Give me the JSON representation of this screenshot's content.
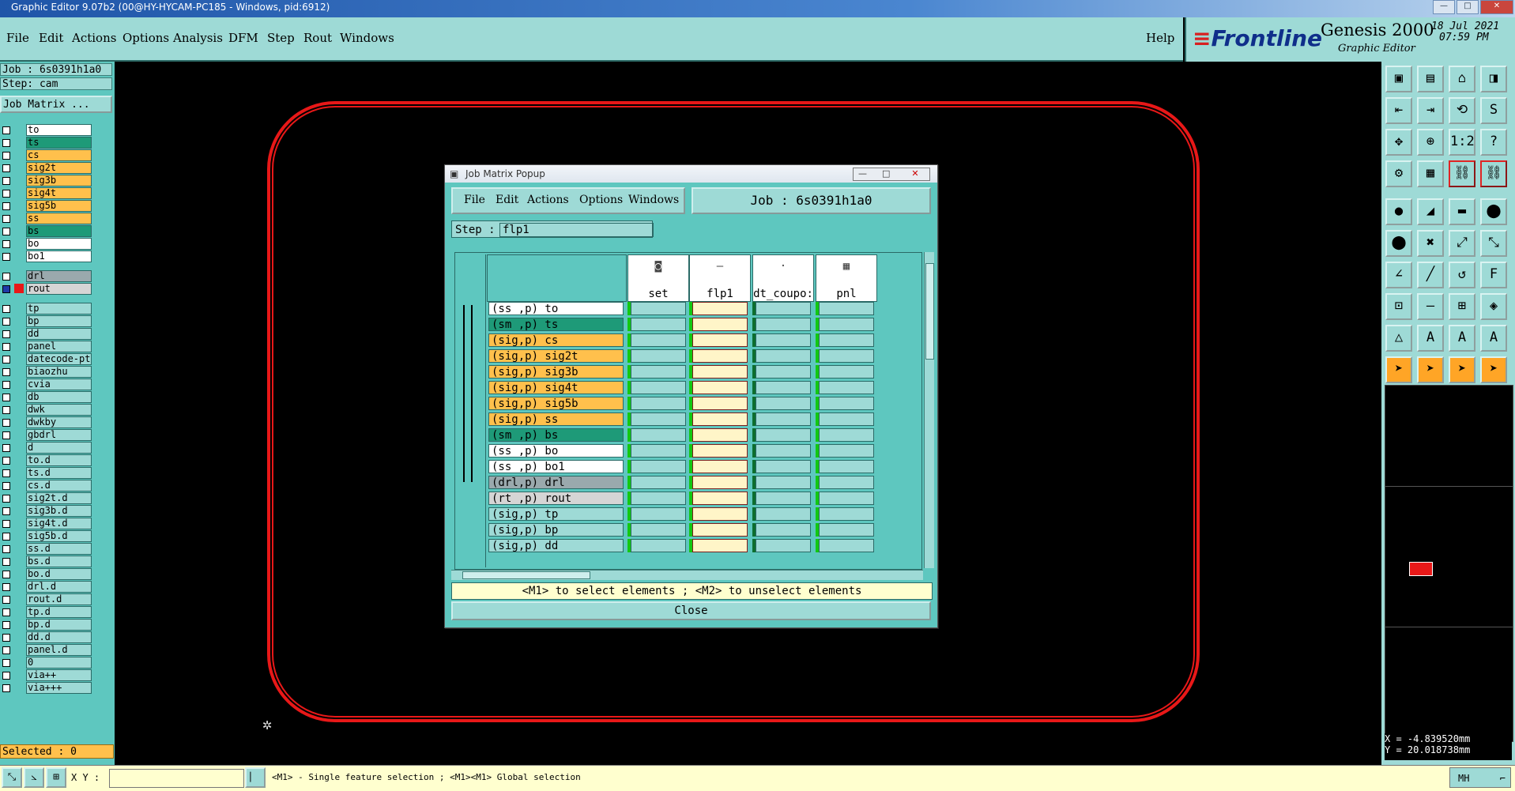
{
  "window": {
    "title": "Graphic Editor 9.07b2 (00@HY-HYCAM-PC185 - Windows, pid:6912)",
    "min": "—",
    "max": "□",
    "close": "✕"
  },
  "menu": {
    "items": [
      "File",
      "Edit",
      "Actions",
      "Options",
      "Analysis",
      "DFM",
      "Step",
      "Rout",
      "Windows"
    ],
    "help": "Help"
  },
  "brand": {
    "logo": "Frontline",
    "product": "Genesis 2000",
    "subtitle": "Graphic Editor",
    "date": "18 Jul 2021",
    "time": "07:59 PM"
  },
  "left": {
    "job": "Job : 6s0391h1a0",
    "step": "Step: cam",
    "job_matrix": "Job Matrix ...",
    "layers": [
      {
        "name": "to",
        "color": "#ffffff"
      },
      {
        "name": "ts",
        "color": "#1e9a78"
      },
      {
        "name": "cs",
        "color": "#ffc04c"
      },
      {
        "name": "sig2t",
        "color": "#ffc04c"
      },
      {
        "name": "sig3b",
        "color": "#ffc04c"
      },
      {
        "name": "sig4t",
        "color": "#ffc04c"
      },
      {
        "name": "sig5b",
        "color": "#ffc04c"
      },
      {
        "name": "ss",
        "color": "#ffc04c"
      },
      {
        "name": "bs",
        "color": "#1e9a78"
      },
      {
        "name": "bo",
        "color": "#ffffff"
      },
      {
        "name": "bo1",
        "color": "#ffffff"
      },
      {
        "name": "drl",
        "color": "#9aa9ad"
      },
      {
        "name": "rout",
        "color": "#d5d5d5"
      },
      {
        "name": "tp",
        "color": "#9edad6"
      },
      {
        "name": "bp",
        "color": "#9edad6"
      },
      {
        "name": "dd",
        "color": "#9edad6"
      },
      {
        "name": "panel",
        "color": "#9edad6"
      },
      {
        "name": "datecode-pt",
        "color": "#9edad6"
      },
      {
        "name": "biaozhu",
        "color": "#9edad6"
      },
      {
        "name": "cvia",
        "color": "#9edad6"
      },
      {
        "name": "db",
        "color": "#9edad6"
      },
      {
        "name": "dwk",
        "color": "#9edad6"
      },
      {
        "name": "dwkby",
        "color": "#9edad6"
      },
      {
        "name": "gbdrl",
        "color": "#9edad6"
      },
      {
        "name": "d",
        "color": "#9edad6"
      },
      {
        "name": "to.d",
        "color": "#9edad6"
      },
      {
        "name": "ts.d",
        "color": "#9edad6"
      },
      {
        "name": "cs.d",
        "color": "#9edad6"
      },
      {
        "name": "sig2t.d",
        "color": "#9edad6"
      },
      {
        "name": "sig3b.d",
        "color": "#9edad6"
      },
      {
        "name": "sig4t.d",
        "color": "#9edad6"
      },
      {
        "name": "sig5b.d",
        "color": "#9edad6"
      },
      {
        "name": "ss.d",
        "color": "#9edad6"
      },
      {
        "name": "bs.d",
        "color": "#9edad6"
      },
      {
        "name": "bo.d",
        "color": "#9edad6"
      },
      {
        "name": "drl.d",
        "color": "#9edad6"
      },
      {
        "name": "rout.d",
        "color": "#9edad6"
      },
      {
        "name": "tp.d",
        "color": "#9edad6"
      },
      {
        "name": "bp.d",
        "color": "#9edad6"
      },
      {
        "name": "dd.d",
        "color": "#9edad6"
      },
      {
        "name": "panel.d",
        "color": "#9edad6"
      },
      {
        "name": "0",
        "color": "#9edad6"
      },
      {
        "name": "via++",
        "color": "#9edad6"
      },
      {
        "name": "via+++",
        "color": "#9edad6"
      }
    ],
    "selected": "Selected : 0"
  },
  "popup": {
    "title": "Job Matrix Popup",
    "menu": [
      "File",
      "Edit",
      "Actions",
      "Options",
      "Windows"
    ],
    "job": "Job : 6s0391h1a0",
    "step_label": "Step :",
    "step_value": "flp1",
    "columns": [
      "set",
      "flp1",
      "dt_coupo:",
      "pnl"
    ],
    "rows": [
      {
        "label": "(ss ,p) to",
        "color": "#ffffff"
      },
      {
        "label": "(sm ,p) ts",
        "color": "#1e9a78"
      },
      {
        "label": "(sig,p) cs",
        "color": "#ffc04c"
      },
      {
        "label": "(sig,p) sig2t",
        "color": "#ffc04c"
      },
      {
        "label": "(sig,p) sig3b",
        "color": "#ffc04c"
      },
      {
        "label": "(sig,p) sig4t",
        "color": "#ffc04c"
      },
      {
        "label": "(sig,p) sig5b",
        "color": "#ffc04c"
      },
      {
        "label": "(sig,p) ss",
        "color": "#ffc04c"
      },
      {
        "label": "(sm ,p) bs",
        "color": "#1e9a78"
      },
      {
        "label": "(ss ,p) bo",
        "color": "#ffffff"
      },
      {
        "label": "(ss ,p) bo1",
        "color": "#ffffff"
      },
      {
        "label": "(drl,p) drl",
        "color": "#9aa9ad"
      },
      {
        "label": "(rt ,p) rout",
        "color": "#d5d5d5"
      },
      {
        "label": "(sig,p) tp",
        "color": "#9edad6"
      },
      {
        "label": "(sig,p) bp",
        "color": "#9edad6"
      },
      {
        "label": "(sig,p) dd",
        "color": "#9edad6"
      }
    ],
    "hint": "<M1> to select elements ; <M2> to unselect elements",
    "close": "Close"
  },
  "right": {
    "tools": [
      "▣",
      "▤",
      "⌂",
      "◨",
      "⇤",
      "⇥",
      "⟲",
      "S",
      "✥",
      "⊕",
      "1:2",
      "?",
      "⚙",
      "▦",
      "⛓",
      "⛓",
      "●",
      "◢",
      "▬",
      "⬤",
      "⬤",
      "✖",
      "⤢",
      "⤡",
      "∠",
      "╱",
      "↺",
      "F",
      "⊡",
      "—",
      "⊞",
      "◈",
      "△",
      "A",
      "A",
      "A",
      "➤",
      "➤",
      "➤",
      "➤"
    ],
    "x": "X = -4.839520mm",
    "y": "Y = 20.018738mm"
  },
  "bottom": {
    "xy_label": "X Y :",
    "xy_value": "",
    "status": "<M1> - Single feature selection ; <M1><M1> Global selection",
    "mode": "MH"
  }
}
